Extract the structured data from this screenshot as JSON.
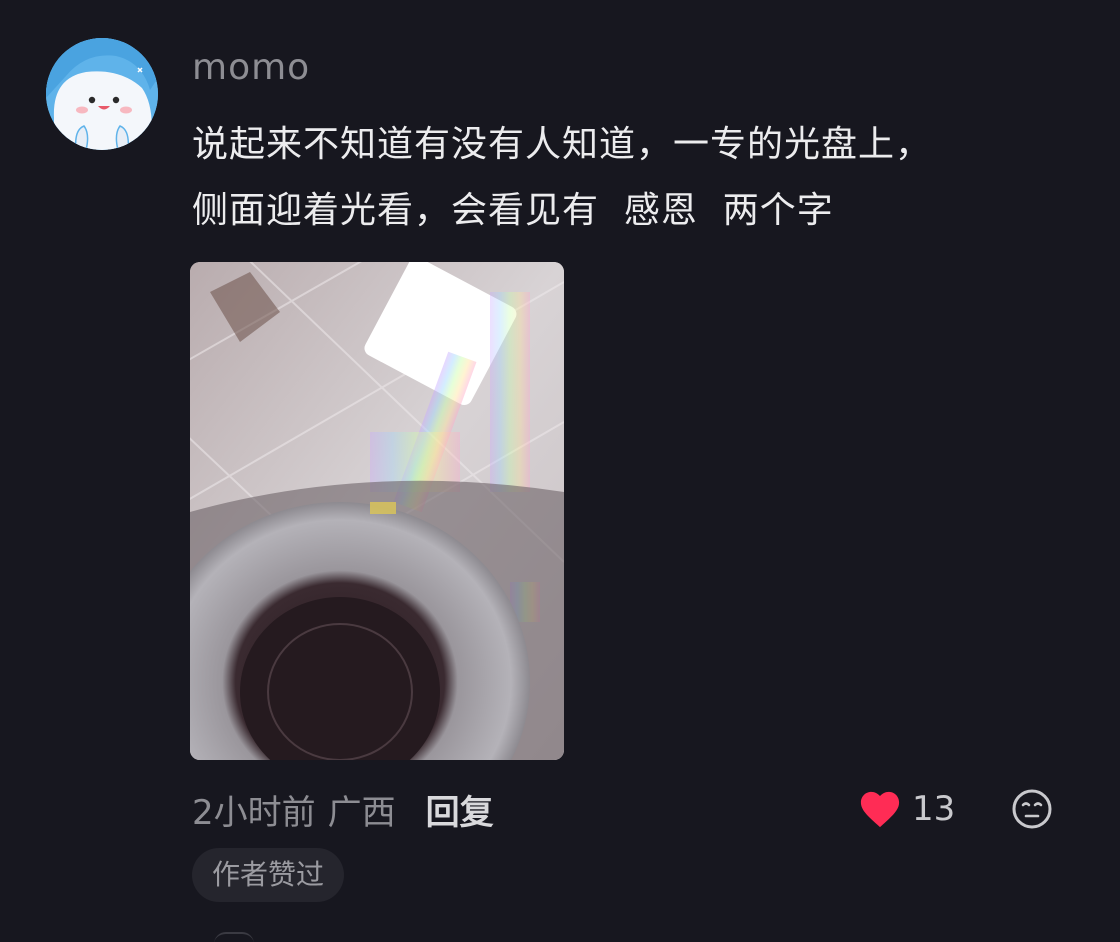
{
  "comment": {
    "username": "momo",
    "content": "说起来不知道有没有人知道，一专的光盘上，\n侧面迎着光看，会看见有  感恩  两个字",
    "meta": {
      "time": "2小时前",
      "region": "广西",
      "reply_label": "回复"
    },
    "likes": {
      "count": "13"
    },
    "badge": "作者赞过"
  },
  "colors": {
    "background": "#17171f",
    "like_red": "#ff2c55",
    "secondary_text": "#8d8d93",
    "avatar_blue": "#5fb3ea"
  },
  "icons": {
    "avatar": "cartoon-avatar-icon",
    "like": "heart-icon",
    "dislike": "meh-face-icon"
  }
}
